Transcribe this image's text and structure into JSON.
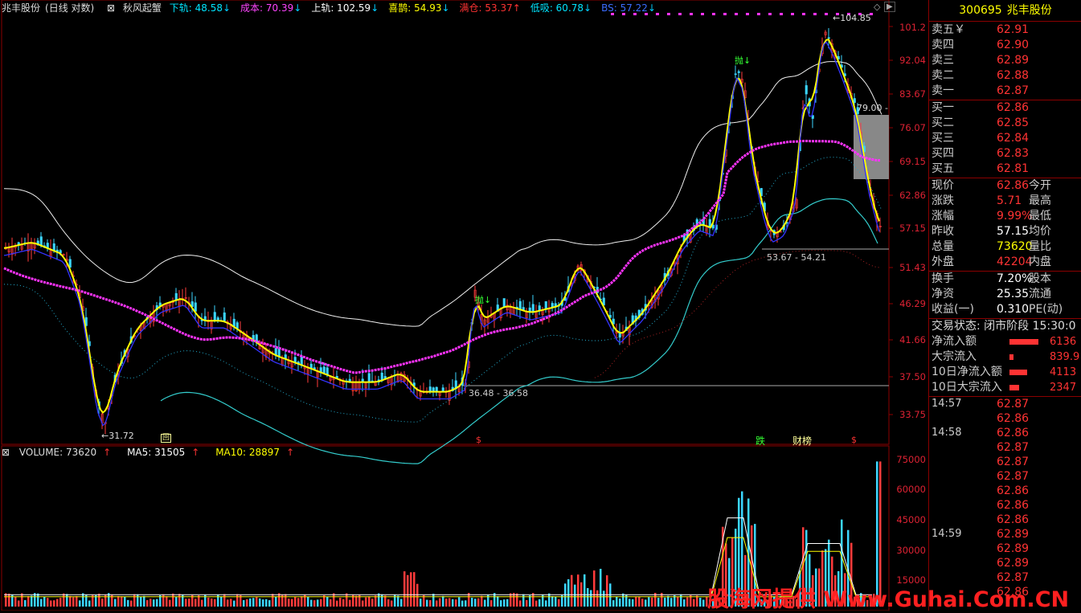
{
  "header": {
    "stock": "兆丰股份",
    "mode": "(日线 对数)",
    "indicator": "秋风起蟹",
    "items": [
      {
        "label": "下轨",
        "value": "48.58",
        "arrow": "↓",
        "color": "#00e5ff"
      },
      {
        "label": "成本",
        "value": "70.39",
        "arrow": "↓",
        "color": "#ff44ff"
      },
      {
        "label": "上轨",
        "value": "102.59",
        "arrow": "↓",
        "color": "#ffffff"
      },
      {
        "label": "喜鹊",
        "value": "54.93",
        "arrow": "↓",
        "color": "#ffff00"
      },
      {
        "label": "满仓",
        "value": "53.37",
        "arrow": "↑",
        "color": "#ff3333"
      },
      {
        "label": "低吸",
        "value": "60.78",
        "arrow": "↓",
        "color": "#00e5ff"
      },
      {
        "label": "BS",
        "value": "57.22",
        "arrow": "↓",
        "color": "#3a6cff"
      }
    ]
  },
  "price_axis": [
    "101.2",
    "92.04",
    "83.67",
    "76.07",
    "69.15",
    "62.86",
    "57.15",
    "51.43",
    "46.29",
    "41.66",
    "37.50",
    "33.75"
  ],
  "volume_axis": [
    "75000",
    "60000",
    "45000",
    "30000",
    "15000"
  ],
  "volume_header": {
    "volume": "VOLUME: 73620",
    "ma5": "MA5: 31505",
    "ma10": "MA10: 28897"
  },
  "annotations": {
    "high": "104.85",
    "low": "31.72",
    "range_a": "36.48 - 36.58",
    "range_b": "53.67 - 54.21",
    "level": "79.00",
    "sell_signal": "抛↓",
    "sell_signal2": "抛↓",
    "mark_fall": "跌",
    "mark_list": "财榜",
    "dollar": "$"
  },
  "panel": {
    "code": "300695",
    "name": "兆丰股份",
    "asks": [
      {
        "label": "卖五",
        "price": "62.91",
        "suffix": "￥"
      },
      {
        "label": "卖四",
        "price": "62.90"
      },
      {
        "label": "卖三",
        "price": "62.89"
      },
      {
        "label": "卖二",
        "price": "62.88"
      },
      {
        "label": "卖一",
        "price": "62.87"
      }
    ],
    "bids": [
      {
        "label": "买一",
        "price": "62.86"
      },
      {
        "label": "买二",
        "price": "62.85"
      },
      {
        "label": "买三",
        "price": "62.84"
      },
      {
        "label": "买四",
        "price": "62.83"
      },
      {
        "label": "买五",
        "price": "62.81"
      }
    ],
    "quote": [
      {
        "l": "现价",
        "v": "62.86",
        "r": "今开",
        "c": "#ff3333"
      },
      {
        "l": "涨跌",
        "v": "5.71",
        "r": "最高",
        "c": "#ff3333"
      },
      {
        "l": "涨幅",
        "v": "9.99%",
        "r": "最低",
        "c": "#ff3333"
      },
      {
        "l": "昨收",
        "v": "57.15",
        "r": "均价",
        "c": "#ffffff"
      },
      {
        "l": "总量",
        "v": "73620",
        "r": "量比",
        "c": "#ffff00"
      },
      {
        "l": "外盘",
        "v": "42204",
        "r": "内盘",
        "c": "#ff3333"
      }
    ],
    "stats": [
      {
        "l": "换手",
        "v": "7.20%",
        "r": "股本"
      },
      {
        "l": "净资",
        "v": "25.35",
        "r": "流通"
      },
      {
        "l": "收益(一)",
        "v": "0.310",
        "r": "PE(动)"
      }
    ],
    "trade_status": "交易状态: 闭市阶段 15:30:0",
    "flows": [
      {
        "l": "净流入额",
        "v": "6136",
        "bar": 36
      },
      {
        "l": "大宗流入",
        "v": "839.9",
        "bar": 5
      },
      {
        "l": "10日净流入额",
        "v": "4113",
        "bar": 22
      },
      {
        "l": "10日大宗流入",
        "v": "2347",
        "bar": 12
      }
    ],
    "ticks": [
      {
        "time": "14:57",
        "price": "62.87"
      },
      {
        "time": "",
        "price": "62.86"
      },
      {
        "time": "14:58",
        "price": "62.86"
      },
      {
        "time": "",
        "price": "62.87"
      },
      {
        "time": "",
        "price": "62.87"
      },
      {
        "time": "",
        "price": "62.87"
      },
      {
        "time": "",
        "price": "62.86"
      },
      {
        "time": "",
        "price": "62.86"
      },
      {
        "time": "",
        "price": "62.86"
      },
      {
        "time": "14:59",
        "price": "62.89"
      },
      {
        "time": "",
        "price": "62.89"
      },
      {
        "time": "",
        "price": "62.89"
      },
      {
        "time": "",
        "price": "62.87"
      },
      {
        "time": "",
        "price": "62.86"
      }
    ]
  },
  "watermark": "股海网提供 Www.Guhai.Com.CN"
}
